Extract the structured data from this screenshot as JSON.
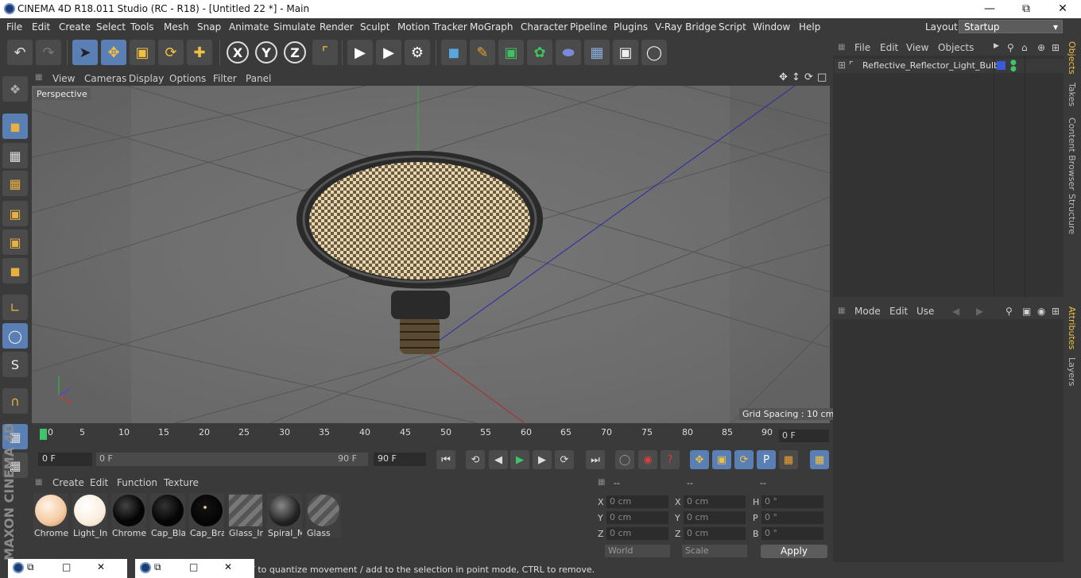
{
  "window": {
    "title": "CINEMA 4D R18.011 Studio (RC - R18) - [Untitled 22 *] - Main"
  },
  "menu": [
    "File",
    "Edit",
    "Create",
    "Select",
    "Tools",
    "Mesh",
    "Snap",
    "Animate",
    "Simulate",
    "Render",
    "Sculpt",
    "Motion Tracker",
    "MoGraph",
    "Character",
    "Pipeline",
    "Plugins",
    "V-Ray Bridge",
    "Script",
    "Window",
    "Help"
  ],
  "layout": {
    "label": "Layout:",
    "value": "Startup"
  },
  "viewport": {
    "menu": [
      "View",
      "Cameras",
      "Display",
      "Options",
      "Filter",
      "Panel"
    ],
    "label": "Perspective",
    "grid_spacing": "Grid Spacing : 10 cm"
  },
  "timeline": {
    "ticks": [
      "0",
      "5",
      "10",
      "15",
      "20",
      "25",
      "30",
      "35",
      "40",
      "45",
      "50",
      "55",
      "60",
      "65",
      "70",
      "75",
      "80",
      "85",
      "90"
    ],
    "current_frame": "0 F",
    "start": "0 F",
    "range_start": "0 F",
    "range_end": "90 F",
    "end": "90 F"
  },
  "materials": {
    "menu": [
      "Create",
      "Edit",
      "Function",
      "Texture"
    ],
    "items": [
      {
        "name": "Chrome",
        "kind": "peach"
      },
      {
        "name": "Light_In",
        "kind": "light"
      },
      {
        "name": "Chrome",
        "kind": "black"
      },
      {
        "name": "Cap_Bla",
        "kind": "black"
      },
      {
        "name": "Cap_Bra",
        "kind": "black"
      },
      {
        "name": "Glass_In",
        "kind": "glass"
      },
      {
        "name": "Spiral_M",
        "kind": "dark"
      },
      {
        "name": "Glass",
        "kind": "glass"
      }
    ]
  },
  "coords": {
    "headers": [
      "--",
      "--",
      "--"
    ],
    "rows": [
      {
        "a": "X",
        "av": "0 cm",
        "b": "X",
        "bv": "0 cm",
        "c": "H",
        "cv": "0 °"
      },
      {
        "a": "Y",
        "av": "0 cm",
        "b": "Y",
        "bv": "0 cm",
        "c": "P",
        "cv": "0 °"
      },
      {
        "a": "Z",
        "av": "0 cm",
        "b": "Z",
        "bv": "0 cm",
        "c": "B",
        "cv": "0 °"
      }
    ],
    "mode1": "World",
    "mode2": "Scale",
    "apply": "Apply"
  },
  "objects": {
    "menu": [
      "File",
      "Edit",
      "View",
      "Objects"
    ],
    "items": [
      "Reflective_Reflector_Light_Bulb"
    ]
  },
  "attributes": {
    "menu": [
      "Mode",
      "Edit",
      "Use"
    ]
  },
  "side_tabs": [
    "Objects",
    "Takes",
    "Content Browser",
    "Structure",
    "Attributes",
    "Layers"
  ],
  "status": "FT to quantize movement / add to the selection in point mode, CTRL to remove.",
  "brand": "MAXON CINEMA 4D",
  "colors": {
    "accent": "#5a7fb5",
    "bg": "#3a3a3a",
    "viewport": "#6d6d6d"
  }
}
